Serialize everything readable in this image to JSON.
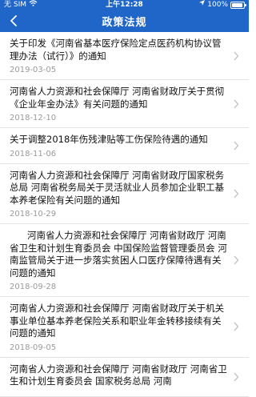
{
  "status_bar": {
    "carrier": "无 SIM",
    "time": "上午12:28",
    "battery_percent": "100%",
    "battery_level": 1.0
  },
  "nav": {
    "title": "政策法规",
    "back_icon": "chevron-left-icon"
  },
  "colors": {
    "primary": "#1f66c8",
    "divider": "#e3e3e3",
    "date_text": "#9a9a9a"
  },
  "items": [
    {
      "title": "关于印发《河南省基本医疗保险定点医药机构协议管理办法（试行）》的通知",
      "date": "2019-03-05"
    },
    {
      "title": "河南省人力资源和社会保障厅 河南省财政厅关于贯彻《企业年金办法》有关问题的通知",
      "date": "2018-12-10"
    },
    {
      "title": "关于调整2018年伤残津贴等工伤保险待遇的通知",
      "date": "2018-11-06"
    },
    {
      "title": "河南省人力资源和社会保障厅 河南省财政厅国家税务总局 河南省税务局关于灵活就业人员参加企业职工基本养老保险有关问题的通知",
      "date": "2018-10-29"
    },
    {
      "title": "河南省人力资源和社会保障厅 河南省财政厅 河南省卫生和计划生育委员会 中国保险监督管理委员会 河南监管局关于进一步落实贫困人口医疗保障待遇有关问题的通知",
      "date": "2018-09-28"
    },
    {
      "title": "河南省人力资源和社会保障厅 河南省财政厅关于机关事业单位基本养老保险关系和职业年金转移接续有关问题的通知",
      "date": "2018-09-05"
    },
    {
      "title": "河南省人力资源和社会保障厅 河南省财政厅 河南省卫生和计划生育委员会 国家税务总局 河南",
      "date": ""
    }
  ]
}
